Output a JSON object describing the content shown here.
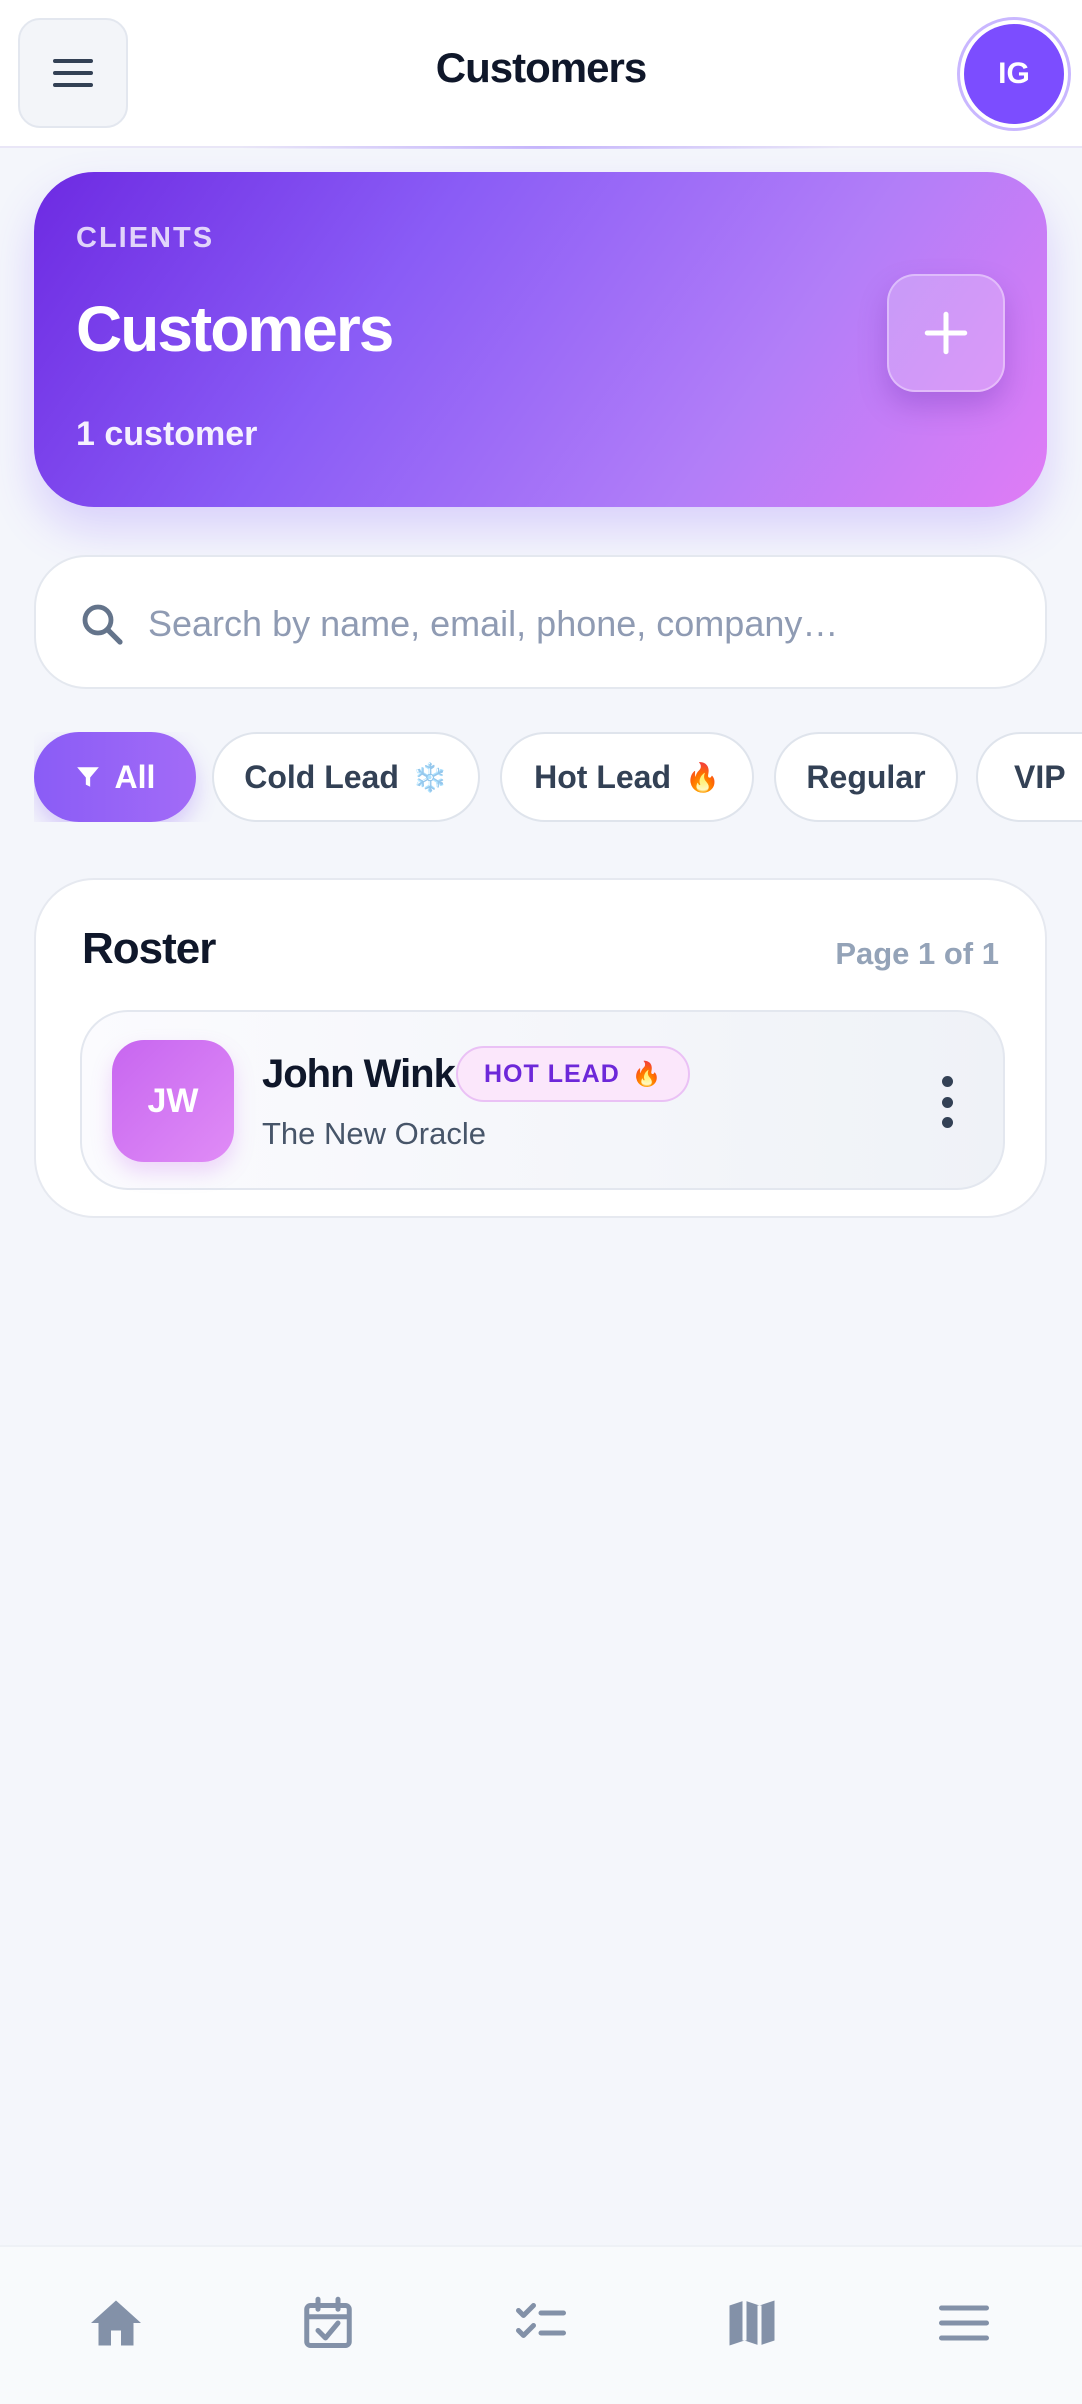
{
  "header": {
    "title": "Customers",
    "avatar_initials": "IG",
    "menu_icon": "hamburger-menu-icon"
  },
  "hero": {
    "eyebrow": "CLIENTS",
    "title": "Customers",
    "subtitle": "1 customer",
    "add_icon": "plus-icon"
  },
  "search": {
    "placeholder": "Search by name, email, phone, company…",
    "value": "",
    "icon": "search-icon"
  },
  "filters": [
    {
      "label": "All",
      "active": true,
      "icon": "filter-icon"
    },
    {
      "label": "Cold Lead",
      "emoji": "❄️",
      "active": false
    },
    {
      "label": "Hot Lead",
      "emoji": "🔥",
      "active": false
    },
    {
      "label": "Regular",
      "active": false
    },
    {
      "label": "VIP",
      "active": false
    }
  ],
  "roster": {
    "title": "Roster",
    "pagination": "Page 1 of 1",
    "customers": [
      {
        "initials": "JW",
        "name": "John Wink",
        "badge": "HOT LEAD",
        "badge_emoji": "🔥",
        "company": "The New Oracle"
      }
    ]
  },
  "bottom_nav": [
    {
      "icon": "home-icon"
    },
    {
      "icon": "calendar-check-icon"
    },
    {
      "icon": "checklist-icon"
    },
    {
      "icon": "map-icon"
    },
    {
      "icon": "menu-icon"
    }
  ],
  "colors": {
    "accent": "#8a5cf6",
    "hero_start": "#6d2ae2",
    "hero_end": "#e07cf5",
    "badge_text": "#6d28d9",
    "nav_icon": "#8391a8"
  }
}
